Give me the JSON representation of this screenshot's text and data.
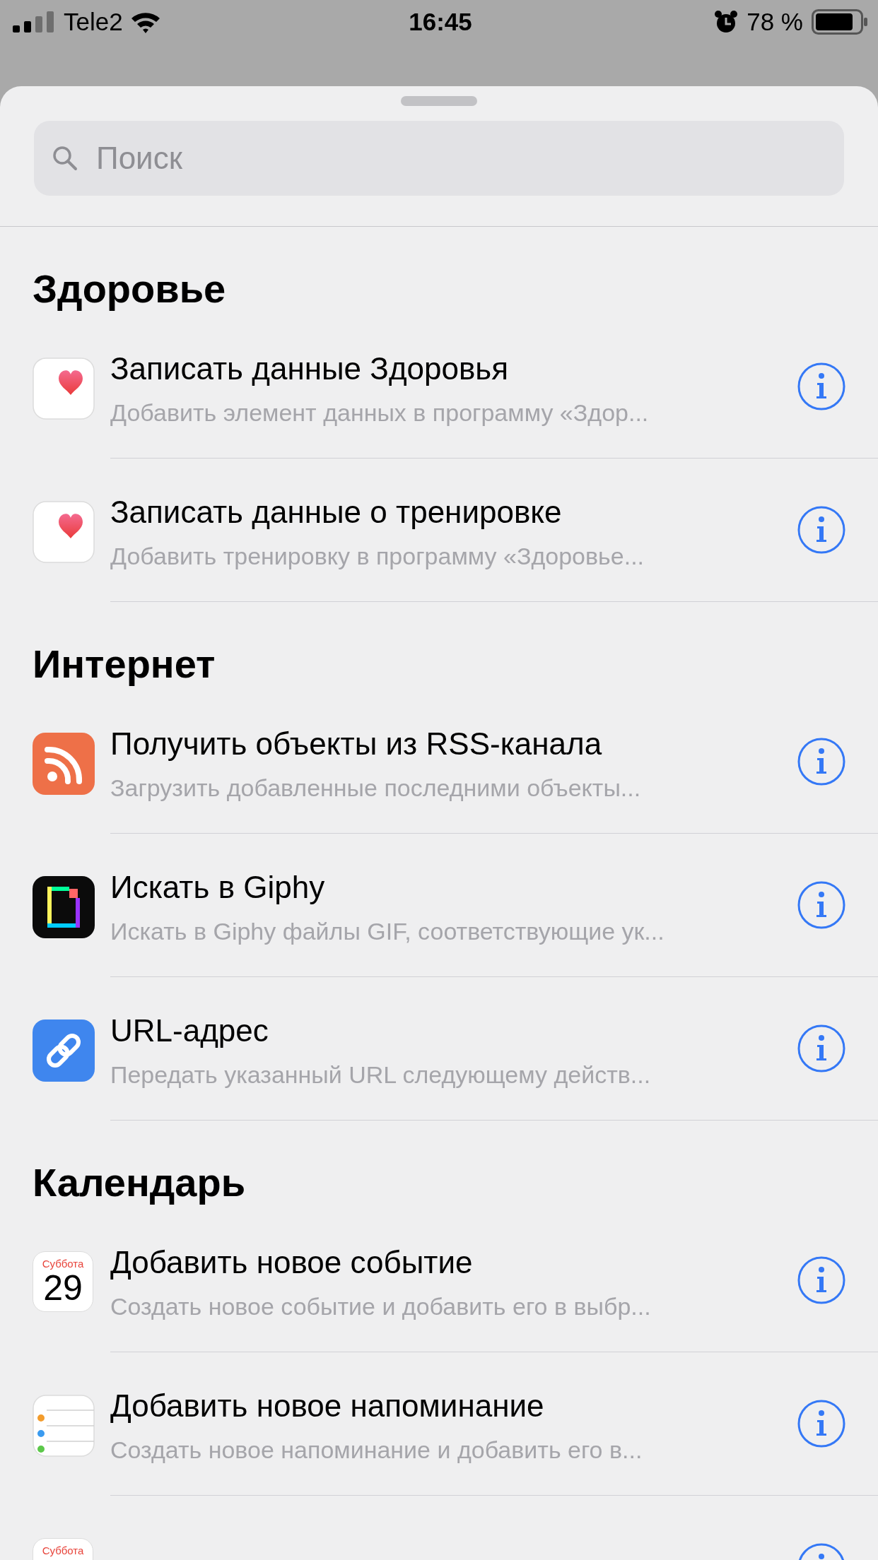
{
  "status_bar": {
    "carrier": "Tele2",
    "time": "16:45",
    "battery": "78 %"
  },
  "search": {
    "placeholder": "Поиск"
  },
  "sections": [
    {
      "header": "Здоровье",
      "actions": [
        {
          "kind": "health",
          "title": "Записать данные Здоровья",
          "subtitle": "Добавить элемент данных в программу «Здор..."
        },
        {
          "kind": "health",
          "title": "Записать данные о тренировке",
          "subtitle": "Добавить тренировку в программу «Здоровье..."
        }
      ]
    },
    {
      "header": "Интернет",
      "actions": [
        {
          "kind": "rss",
          "title": "Получить объекты из RSS-канала",
          "subtitle": "Загрузить добавленные последними объекты..."
        },
        {
          "kind": "giphy",
          "title": "Искать в Giphy",
          "subtitle": "Искать в Giphy файлы GIF, соответствующие ук..."
        },
        {
          "kind": "url",
          "title": "URL-адрес",
          "subtitle": "Передать указанный URL следующему действ..."
        }
      ]
    },
    {
      "header": "Календарь",
      "actions": [
        {
          "kind": "calendar",
          "icon_label": "Суббота",
          "icon_day": "29",
          "title": "Добавить новое событие",
          "subtitle": "Создать новое событие и добавить его в выбр..."
        },
        {
          "kind": "reminders",
          "title": "Добавить новое напоминание",
          "subtitle": "Создать новое напоминание и добавить его в..."
        },
        {
          "kind": "calendar",
          "icon_label": "Суббота"
        }
      ]
    }
  ]
}
